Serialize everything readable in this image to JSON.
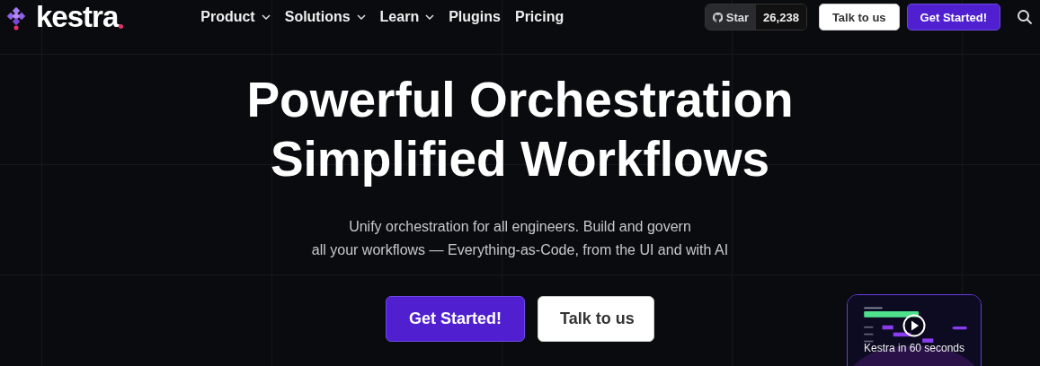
{
  "header": {
    "logo": "kestra",
    "nav": [
      {
        "label": "Product",
        "dropdown": true
      },
      {
        "label": "Solutions",
        "dropdown": true
      },
      {
        "label": "Learn",
        "dropdown": true
      },
      {
        "label": "Plugins",
        "dropdown": false
      },
      {
        "label": "Pricing",
        "dropdown": false
      }
    ],
    "github": {
      "label": "Star",
      "count": "26,238"
    },
    "buttons": [
      {
        "label": "Talk to us",
        "kind": "secondary"
      },
      {
        "label": "Get Started!",
        "kind": "primary"
      }
    ]
  },
  "hero": {
    "title": [
      "Powerful Orchestration",
      "Simplified Workflows"
    ],
    "subtitle": [
      "Unify orchestration for all engineers. Build and govern",
      "all your workflows — Everything-as-Code, from the UI and with AI"
    ],
    "buttons": [
      {
        "label": "Get Started!",
        "kind": "primary"
      },
      {
        "label": "Talk to us",
        "kind": "secondary"
      }
    ]
  },
  "video": {
    "kind": "picture",
    "caption": "Kestra in 60 seconds"
  }
}
